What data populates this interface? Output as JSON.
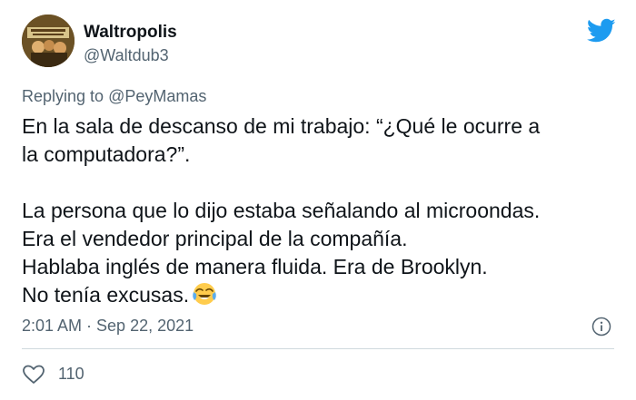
{
  "author": {
    "name": "Waltropolis",
    "handle": "@Waltdub3",
    "avatar_icon": "user-avatar-photo"
  },
  "brand": {
    "logo_icon": "twitter-bird-icon",
    "color": "#1d9bf0"
  },
  "reply": {
    "prefix": "Replying to",
    "mention": "@PeyMamas"
  },
  "tweet": {
    "lines": [
      "En la sala de descanso de mi trabajo: “¿Qué le ocurre a",
      "la computadora?”.",
      "La persona que lo dijo estaba señalando al microondas.",
      "Era el vendedor principal de la compañía.",
      "Hablaba inglés de manera fluida. Era de Brooklyn.",
      "No tenía excusas."
    ],
    "emoji_icon": "face-with-tears-of-joy-icon"
  },
  "meta": {
    "timestamp": "2:01 AM · Sep 22, 2021",
    "info_icon": "info-icon"
  },
  "engagement": {
    "like_icon": "heart-icon",
    "like_count": "110"
  },
  "colors": {
    "text": "#0f1419",
    "secondary": "#536471",
    "divider": "#cfd9de"
  }
}
